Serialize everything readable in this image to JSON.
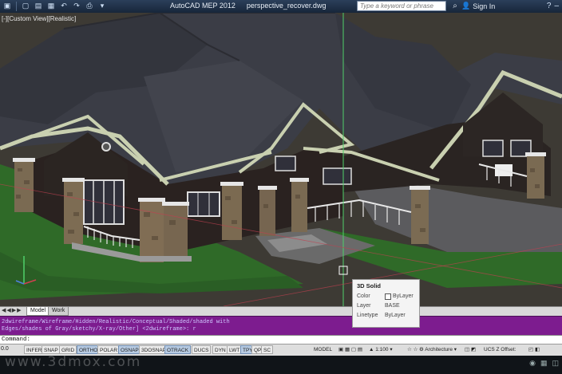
{
  "titlebar": {
    "app_name": "AutoCAD MEP 2012",
    "file_name": "perspective_recover.dwg",
    "search_placeholder": "Type a keyword or phrase",
    "signin_label": "Sign In",
    "qat_icons": [
      "app-menu-icon",
      "new-icon",
      "open-icon",
      "save-icon",
      "undo-icon",
      "redo-icon",
      "plot-icon"
    ]
  },
  "viewport": {
    "view_label": "[-][Custom View][Realistic]",
    "tooltip": {
      "title": "3D Solid",
      "rows": [
        {
          "key": "Color",
          "value": "ByLayer"
        },
        {
          "key": "Layer",
          "value": "BASE"
        },
        {
          "key": "Linetype",
          "value": "ByLayer"
        }
      ]
    }
  },
  "layout_tabs": {
    "model": "Model",
    "work": "Work"
  },
  "command": {
    "line1": "2dwireframe/Wireframe/Hidden/Realistic/Conceptual/Shaded/shaded with",
    "line2": "Edges/shades of Gray/sketchy/X-ray/Other] <2dwireframe>: r",
    "prompt": "Command:"
  },
  "status": {
    "coords": "0.0",
    "toggles": [
      {
        "label": "INFER",
        "on": false
      },
      {
        "label": "SNAP",
        "on": false
      },
      {
        "label": "GRID",
        "on": false
      },
      {
        "label": "ORTHO",
        "on": true
      },
      {
        "label": "POLAR",
        "on": false
      },
      {
        "label": "OSNAP",
        "on": true
      },
      {
        "label": "3DOSNAP",
        "on": false
      },
      {
        "label": "OTRACK",
        "on": true
      },
      {
        "label": "DUCS",
        "on": false
      },
      {
        "label": "DYN",
        "on": false
      },
      {
        "label": "LWT",
        "on": false
      },
      {
        "label": "TPY",
        "on": true
      },
      {
        "label": "QP",
        "on": false
      },
      {
        "label": "SC",
        "on": false
      }
    ],
    "model_label": "MODEL",
    "scale": "1:100",
    "workspace": "Architecture",
    "ucs": "UCS Z Offset:"
  },
  "watermark": "www.3dmox.com",
  "colors": {
    "command_bg": "#7d1c8f",
    "title_bg": "#17263a",
    "roof": "#3a3c44",
    "grass": "#2f6e2a"
  }
}
